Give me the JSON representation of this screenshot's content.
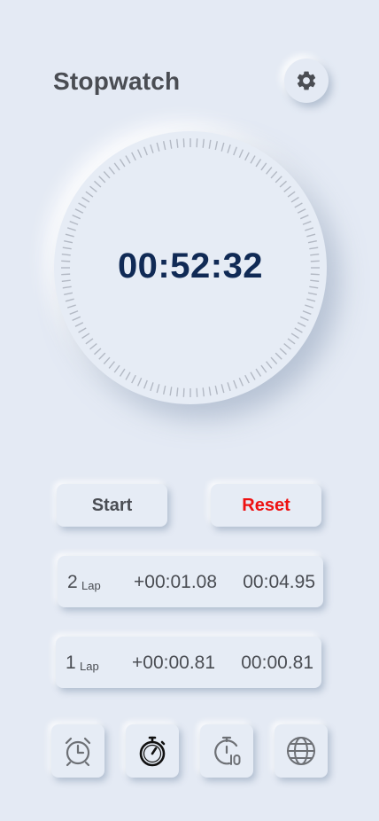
{
  "header": {
    "title": "Stopwatch",
    "settings_icon": "gear-icon"
  },
  "stopwatch": {
    "time": "00:52:32",
    "tick_count": 120
  },
  "controls": {
    "start_label": "Start",
    "reset_label": "Reset",
    "reset_color": "#ee1111"
  },
  "laps": [
    {
      "number": "2",
      "label": "Lap",
      "split": "+00:01.08",
      "total": "00:04.95"
    },
    {
      "number": "1",
      "label": "Lap",
      "split": "+00:00.81",
      "total": "00:00.81"
    }
  ],
  "nav": [
    {
      "icon": "alarm-clock-icon",
      "active": false
    },
    {
      "icon": "stopwatch-icon",
      "active": true
    },
    {
      "icon": "timer-10-icon",
      "active": false
    },
    {
      "icon": "globe-icon",
      "active": false
    }
  ],
  "colors": {
    "background": "#e4eaf4",
    "time_text": "#102a55",
    "text": "#4a4d53"
  }
}
